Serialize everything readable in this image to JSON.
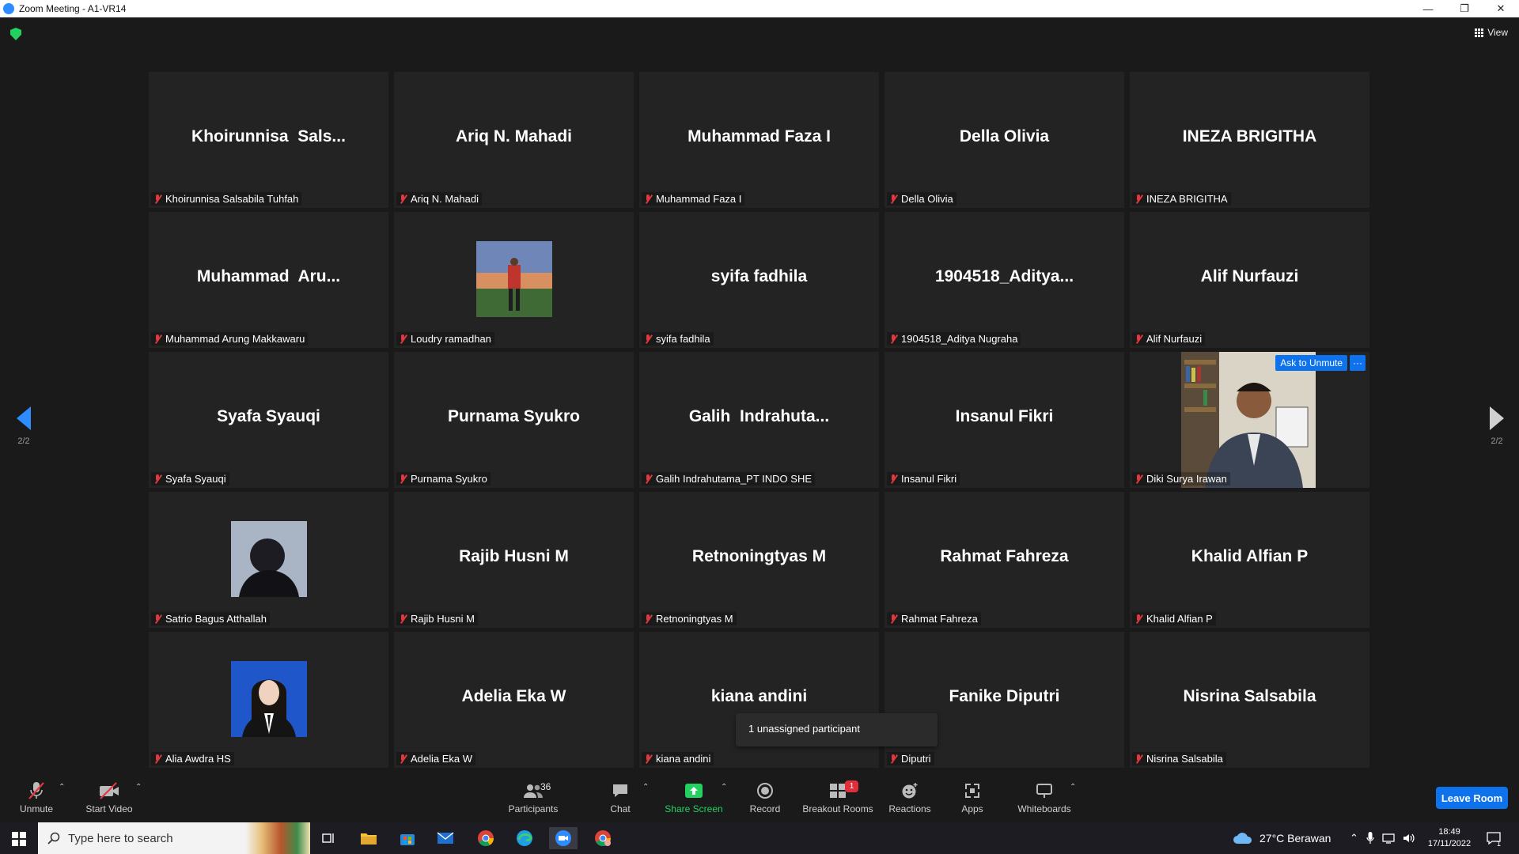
{
  "window": {
    "title": "Zoom Meeting - A1-VR14",
    "controls": [
      "—",
      "❐",
      "✕"
    ]
  },
  "view_button": {
    "label": "View"
  },
  "pager": {
    "left_page": "2/2",
    "right_page": "2/2"
  },
  "participants": [
    {
      "display": "Khoirunnisa  Sals...",
      "label": "Khoirunnisa Salsabila Tuhfah"
    },
    {
      "display": "Ariq N. Mahadi",
      "label": "Ariq N. Mahadi"
    },
    {
      "display": "Muhammad Faza I",
      "label": "Muhammad Faza I"
    },
    {
      "display": "Della Olivia",
      "label": "Della Olivia"
    },
    {
      "display": "INEZA BRIGITHA",
      "label": "INEZA BRIGITHA"
    },
    {
      "display": "Muhammad  Aru...",
      "label": "Muhammad Arung Makkawaru"
    },
    {
      "display": "",
      "label": "Loudry ramadhan",
      "photo": "photo-football-player"
    },
    {
      "display": "syifa fadhila",
      "label": "syifa fadhila"
    },
    {
      "display": "1904518_Aditya...",
      "label": "1904518_Aditya Nugraha"
    },
    {
      "display": "Alif Nurfauzi",
      "label": "Alif Nurfauzi"
    },
    {
      "display": "Syafa Syauqi",
      "label": "Syafa Syauqi"
    },
    {
      "display": "Purnama Syukro",
      "label": "Purnama Syukro"
    },
    {
      "display": "Galih  Indrahuta...",
      "label": "Galih Indrahutama_PT INDO SHE"
    },
    {
      "display": "Insanul Fikri",
      "label": "Insanul Fikri"
    },
    {
      "display": "",
      "label": "Diki Surya Irawan",
      "video": "video-man-in-office",
      "ask_to_unmute": "Ask to Unmute",
      "more": "···"
    },
    {
      "display": "",
      "label": "Satrio Bagus Atthallah",
      "photo": "photo-portrait-dark"
    },
    {
      "display": "Rajib Husni M",
      "label": "Rajib Husni M"
    },
    {
      "display": "Retnoningtyas M",
      "label": "Retnoningtyas M"
    },
    {
      "display": "Rahmat Fahreza",
      "label": "Rahmat Fahreza"
    },
    {
      "display": "Khalid Alfian P",
      "label": "Khalid Alfian P"
    },
    {
      "display": "",
      "label": "Alia Awdra HS",
      "photo": "photo-portrait-formal"
    },
    {
      "display": "Adelia Eka W",
      "label": "Adelia Eka W"
    },
    {
      "display": "kiana andini",
      "label": "kiana andini"
    },
    {
      "display": "Fanike Diputri",
      "label": "Diputri"
    },
    {
      "display": "Nisrina Salsabila",
      "label": "Nisrina Salsabila"
    }
  ],
  "tooltip": {
    "text": "1 unassigned participant"
  },
  "toolbar": {
    "unmute": "Unmute",
    "start_video": "Start Video",
    "participants": "Participants",
    "participants_count": "36",
    "chat": "Chat",
    "share_screen": "Share Screen",
    "record": "Record",
    "breakout_rooms": "Breakout Rooms",
    "breakout_badge": "1",
    "reactions": "Reactions",
    "apps": "Apps",
    "whiteboards": "Whiteboards",
    "leave": "Leave Room",
    "caret": "⌃"
  },
  "taskbar": {
    "search_placeholder": "Type here to search",
    "weather": "27°C  Berawan",
    "time": "18:49",
    "date": "17/11/2022",
    "notification_count": "1"
  },
  "colors": {
    "accent_blue": "#0e72ed",
    "share_green": "#23d160",
    "mute_red": "#e0383e",
    "tile_bg": "#232323",
    "meeting_bg": "#1a1a1a"
  }
}
